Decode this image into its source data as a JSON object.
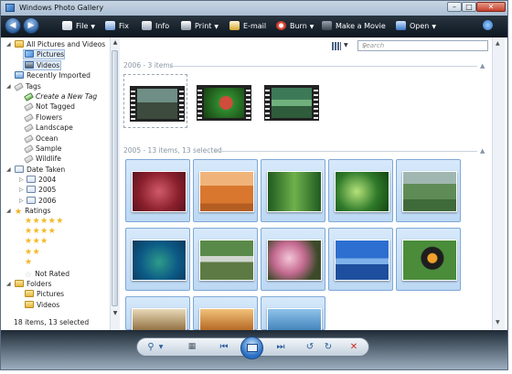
{
  "window": {
    "title": "Windows Photo Gallery",
    "min": "–",
    "max": "□",
    "close": "✕"
  },
  "toolbar": {
    "back_icon": "back-arrow-icon",
    "forward_icon": "forward-arrow-icon",
    "items": [
      {
        "label": "File",
        "icon": "file-icon",
        "dropdown": true
      },
      {
        "label": "Fix",
        "icon": "fix-icon",
        "dropdown": false
      },
      {
        "label": "Info",
        "icon": "info-icon",
        "dropdown": false
      },
      {
        "label": "Print",
        "icon": "print-icon",
        "dropdown": true
      },
      {
        "label": "E-mail",
        "icon": "email-icon",
        "dropdown": false
      },
      {
        "label": "Burn",
        "icon": "burn-icon",
        "dropdown": true
      },
      {
        "label": "Make a Movie",
        "icon": "movie-icon",
        "dropdown": false
      },
      {
        "label": "Open",
        "icon": "open-icon",
        "dropdown": true
      },
      {
        "label": "",
        "icon": "help-icon",
        "dropdown": false
      }
    ]
  },
  "nav": {
    "all_pictures": "All Pictures and Videos",
    "pictures": "Pictures",
    "videos": "Videos",
    "recently_imported": "Recently Imported",
    "tags": "Tags",
    "tag_items": [
      "Create a New Tag",
      "Not Tagged",
      "Flowers",
      "Landscape",
      "Ocean",
      "Sample",
      "Wildlife"
    ],
    "date_taken": "Date Taken",
    "years": [
      "2004",
      "2005",
      "2006"
    ],
    "ratings": "Ratings",
    "rating_rows": [
      5,
      4,
      3,
      2,
      1
    ],
    "not_rated": "Not Rated",
    "folders": "Folders",
    "folder_items": [
      "Pictures",
      "Videos"
    ],
    "status": "18 items, 13 selected"
  },
  "main": {
    "search_placeholder": "Search",
    "groups": [
      {
        "header": "2006 - 3 items"
      },
      {
        "header": "2005 - 13 items, 13 selected"
      }
    ]
  },
  "colors": {
    "accent": "#2a6fc4",
    "toolbar_bg": "#1b2530",
    "selection": "#bcd8f3"
  }
}
